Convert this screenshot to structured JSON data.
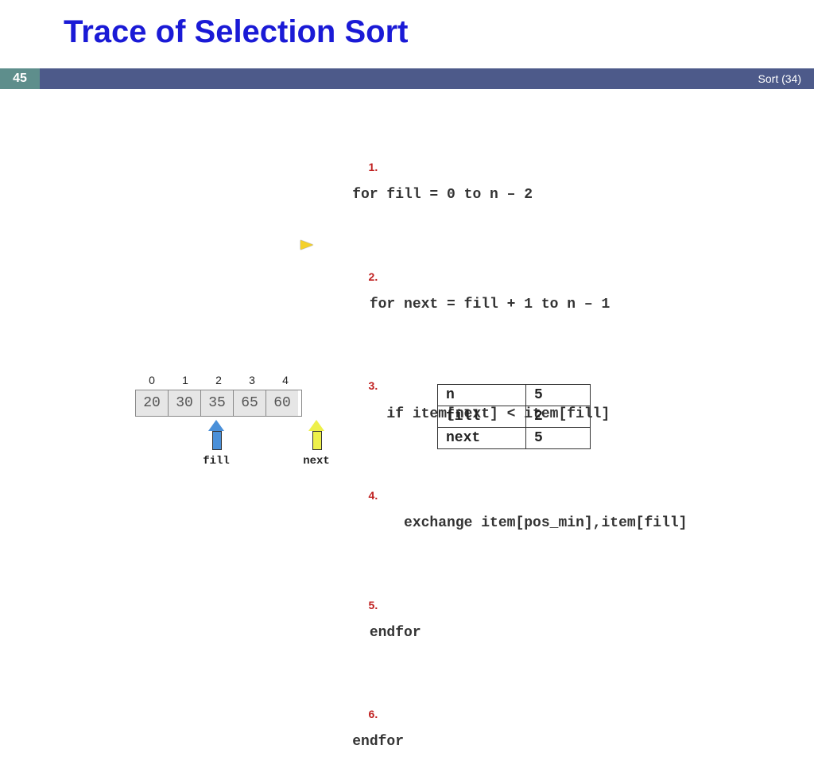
{
  "header": {
    "title": "Trace of Selection Sort",
    "page_number": "45",
    "section_label": "Sort (34)"
  },
  "code": {
    "current_line": 5,
    "lines": [
      {
        "n": "1.",
        "text": "for fill = 0 to n – 2"
      },
      {
        "n": "2.",
        "text": "  for next = fill + 1 to n – 1"
      },
      {
        "n": "3.",
        "text": "    if item[next] < item[fill]"
      },
      {
        "n": "4.",
        "text": "      exchange item[pos_min],item[fill]"
      },
      {
        "n": "5.",
        "text": "  endfor"
      },
      {
        "n": "6.",
        "text": "endfor"
      }
    ]
  },
  "array": {
    "indices": [
      "0",
      "1",
      "2",
      "3",
      "4"
    ],
    "values": [
      "20",
      "30",
      "35",
      "65",
      "60"
    ],
    "fill_label": "fill",
    "next_label": "next",
    "fill_index": 2,
    "next_index": 5
  },
  "state": {
    "rows": [
      {
        "k": "n",
        "v": "5"
      },
      {
        "k": "fill",
        "v": "2"
      },
      {
        "k": "next",
        "v": "5"
      }
    ]
  }
}
